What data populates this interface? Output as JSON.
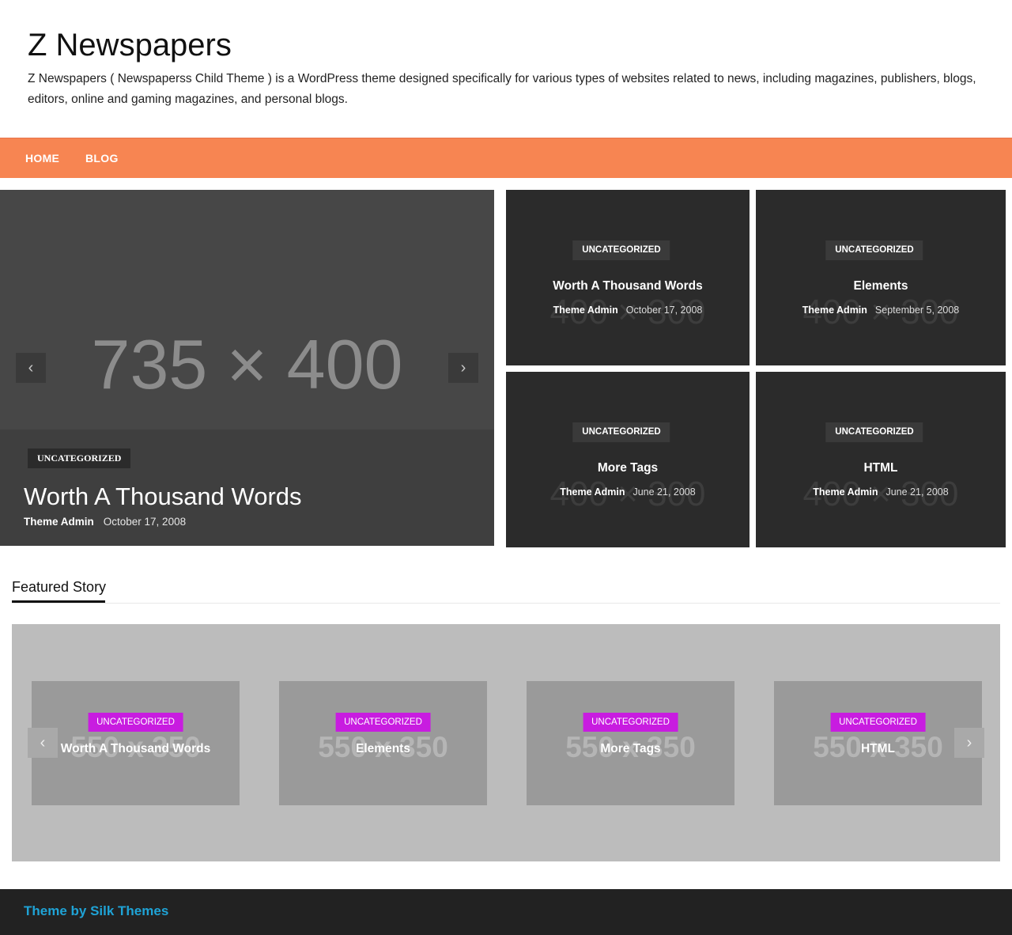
{
  "site": {
    "title": "Z Newspapers",
    "description": "Z Newspapers ( Newspaperss Child Theme ) is a WordPress theme designed specifically for various types of websites related to news, including magazines, publishers, blogs, editors, online and gaming magazines, and personal blogs."
  },
  "nav": {
    "items": [
      {
        "label": "HOME"
      },
      {
        "label": "BLOG"
      }
    ]
  },
  "hero": {
    "placeholder": "735 × 400",
    "prev_icon": "‹",
    "next_icon": "›",
    "category": "UNCATEGORIZED",
    "title": "Worth A Thousand Words",
    "author": "Theme Admin",
    "date": "October 17, 2008"
  },
  "grid": [
    {
      "placeholder": "400 × 300",
      "category": "UNCATEGORIZED",
      "title": "Worth A Thousand Words",
      "author": "Theme Admin",
      "date": "October 17, 2008"
    },
    {
      "placeholder": "400 × 300",
      "category": "UNCATEGORIZED",
      "title": "Elements",
      "author": "Theme Admin",
      "date": "September 5, 2008"
    },
    {
      "placeholder": "400 × 300",
      "category": "UNCATEGORIZED",
      "title": "More Tags",
      "author": "Theme Admin",
      "date": "June 21, 2008"
    },
    {
      "placeholder": "400 × 300",
      "category": "UNCATEGORIZED",
      "title": "HTML",
      "author": "Theme Admin",
      "date": "June 21, 2008"
    }
  ],
  "featured": {
    "heading": "Featured Story",
    "prev_icon": "‹",
    "next_icon": "›",
    "items": [
      {
        "placeholder": "550 x 350",
        "category": "UNCATEGORIZED",
        "title": "Worth A Thousand Words"
      },
      {
        "placeholder": "550 x 350",
        "category": "UNCATEGORIZED",
        "title": "Elements"
      },
      {
        "placeholder": "550 x 350",
        "category": "UNCATEGORIZED",
        "title": "More Tags"
      },
      {
        "placeholder": "550 x 350",
        "category": "UNCATEGORIZED",
        "title": "HTML"
      }
    ]
  },
  "footer": {
    "credit": "Theme by Silk Themes"
  },
  "colors": {
    "nav_bg": "#f78552",
    "featured_badge": "#c81ce0",
    "footer_link": "#1fa3d6",
    "footer_bg": "#222222"
  }
}
